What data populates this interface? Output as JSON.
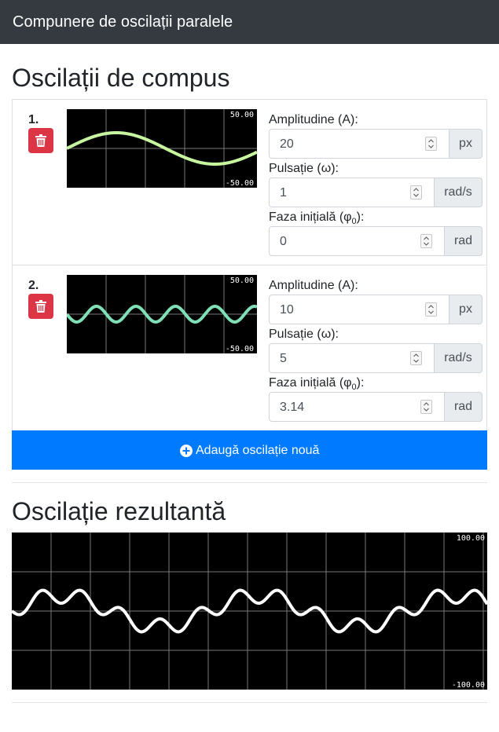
{
  "navbar": {
    "title": "Compunere de oscilații paralele"
  },
  "components_heading": "Oscilații de compus",
  "oscillators": [
    {
      "index": "1.",
      "amplitude": "20",
      "omega": "1",
      "phase": "0",
      "amp_unit": "px",
      "omega_unit": "rad/s",
      "phase_unit": "rad",
      "scale_max": "50.00",
      "scale_min": "-50.00",
      "color": "#c8f5a0"
    },
    {
      "index": "2.",
      "amplitude": "10",
      "omega": "5",
      "phase": "3.14",
      "amp_unit": "px",
      "omega_unit": "rad/s",
      "phase_unit": "rad",
      "scale_max": "50.00",
      "scale_min": "-50.00",
      "color": "#7fe0b8"
    }
  ],
  "labels": {
    "amplitude": "Amplitudine (A):",
    "omega": "Pulsație (ω):",
    "phase_prefix": "Faza inițială (φ",
    "phase_sub": "0",
    "phase_suffix": "):"
  },
  "icons": {
    "delete": "trash-icon",
    "add": "plus-circle-icon"
  },
  "add_button": {
    "label": "Adaugă oscilație nouă"
  },
  "result_heading": "Oscilație rezultantă",
  "result": {
    "scale_max": "100.00",
    "scale_min": "-100.00",
    "color": "#ffffff"
  }
}
